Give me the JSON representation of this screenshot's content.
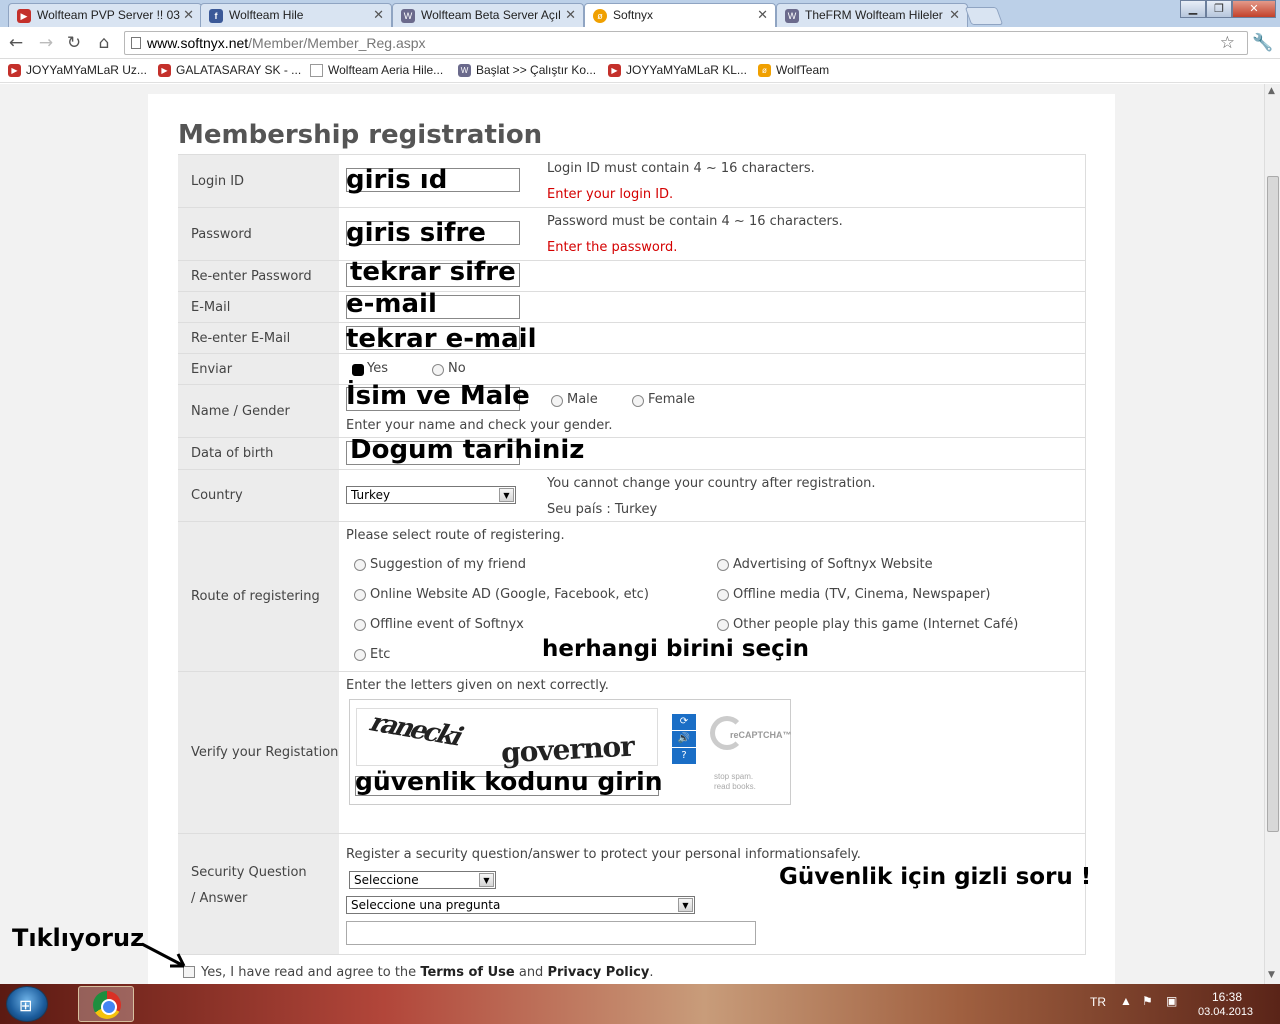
{
  "browser": {
    "tabs": [
      {
        "title": "Wolfteam PVP Server !! 03",
        "icon": "youtube-icon"
      },
      {
        "title": "Wolfteam Hile",
        "icon": "facebook-icon"
      },
      {
        "title": "Wolfteam Beta Server Açıl",
        "icon": "wolfteam-icon"
      },
      {
        "title": "Softnyx",
        "icon": "softnyx-icon"
      },
      {
        "title": "TheFRM Wolfteam Hileler",
        "icon": "wolfteam-icon"
      }
    ],
    "url_host": "www.softnyx.net",
    "url_path": "/Member/Member_Reg.aspx",
    "bookmarks": [
      {
        "label": "JOYYaMYaMLaR Uz..."
      },
      {
        "label": "GALATASARAY SK - ..."
      },
      {
        "label": "Wolfteam Aeria Hile..."
      },
      {
        "label": "Başlat >> Çalıştır Ko..."
      },
      {
        "label": "JOYYaMYaMLaR KL..."
      },
      {
        "label": "WolfTeam"
      }
    ]
  },
  "page": {
    "title": "Membership registration",
    "fields": {
      "login_id": {
        "label": "Login ID",
        "value": "giris ıd",
        "hint": "Login ID must contain 4 ~ 16 characters.",
        "error": "Enter your login ID."
      },
      "password": {
        "label": "Password",
        "value": "giris sifre",
        "hint": "Password must be contain 4 ~ 16 characters.",
        "error": "Enter the password."
      },
      "reenter_password": {
        "label": "Re-enter Password",
        "value": "tekrar sifre"
      },
      "email": {
        "label": "E-Mail",
        "value": "e-mail"
      },
      "reenter_email": {
        "label": "Re-enter E-Mail",
        "value": "tekrar e-mail"
      },
      "enviar": {
        "label": "Enviar",
        "yes": "Yes",
        "no": "No"
      },
      "name_gender": {
        "label": "Name / Gender",
        "value": "İsim ve Male",
        "male": "Male",
        "female": "Female",
        "hint": "Enter your name and check your gender."
      },
      "birth": {
        "label": "Data of birth",
        "value": "Dogum tarihiniz"
      },
      "country": {
        "label": "Country",
        "selected": "Turkey",
        "hint": "You cannot change your country after registration.",
        "current": "Seu país : Turkey"
      },
      "route": {
        "label": "Route of registering",
        "prompt": "Please select route of registering.",
        "options": [
          "Suggestion of my friend",
          "Advertising of Softnyx Website",
          "Online Website AD (Google, Facebook, etc)",
          "Offline media (TV, Cinema, Newspaper)",
          "Offline event of Softnyx",
          "Other people play this game (Internet Café)",
          "Etc"
        ],
        "note": "herhangi birini seçin"
      },
      "verify": {
        "label": "Verify your Registation",
        "prompt": "Enter the letters given on next correctly.",
        "captcha_word1": "ranecki",
        "captcha_word2": "governor",
        "recaptcha": "reCAPTCHA™",
        "tagline1": "stop spam.",
        "tagline2": "read books.",
        "value": "güvenlik kodunu girin"
      },
      "security": {
        "label1": "Security Question",
        "label2": "/ Answer",
        "prompt": "Register a security question/answer to protect your personal informationsafely.",
        "select1": "Seleccione",
        "select2": "Seleccione una pregunta",
        "note": "Güvenlik için gizli soru !"
      }
    },
    "agree": {
      "prefix": "Yes, I have read and agree to the ",
      "terms": "Terms of Use",
      "and": " and ",
      "privacy": "Privacy Policy",
      "suffix": "."
    },
    "annotation_click": "Tıklıyoruz"
  },
  "taskbar": {
    "lang": "TR",
    "time": "16:38",
    "date": "03.04.2013"
  }
}
